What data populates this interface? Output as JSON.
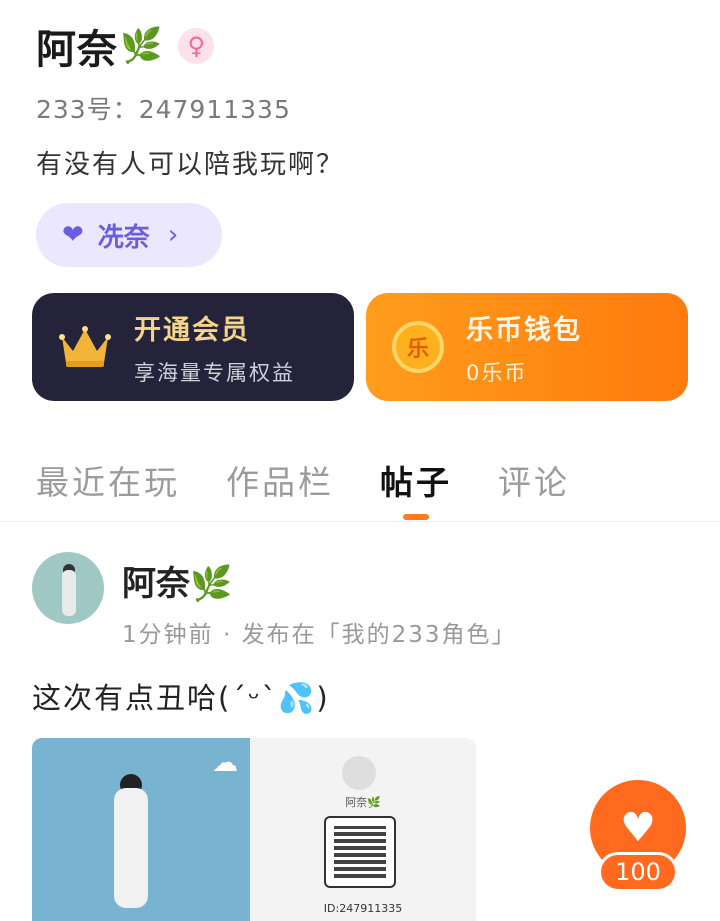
{
  "profile": {
    "name": "阿奈",
    "name_leaf": "🌿",
    "gender_icon": "female-icon",
    "id_label": "233号：",
    "id_value": "247911335",
    "bio": "有没有人可以陪我玩啊？",
    "cp_label": "冼奈",
    "cp_icon": "couple-heart-icon"
  },
  "cards": {
    "vip": {
      "title": "开通会员",
      "subtitle": "享海量专属权益",
      "icon": "crown-icon"
    },
    "wallet": {
      "title": "乐币钱包",
      "subtitle": "0乐币",
      "icon_text": "乐"
    }
  },
  "tabs": [
    {
      "label": "最近在玩",
      "active": false
    },
    {
      "label": "作品栏",
      "active": false
    },
    {
      "label": "帖子",
      "active": true
    },
    {
      "label": "评论",
      "active": false
    }
  ],
  "post": {
    "author": "阿奈",
    "author_leaf": "🌿",
    "time_text": "1分钟前 · 发布在「我的233角色」",
    "content": "这次有点丑哈(´ᵕ`💦)",
    "share_card": {
      "name": "阿奈🌿",
      "id_text": "ID:247911335"
    }
  },
  "like": {
    "count": "100"
  },
  "colors": {
    "accent": "#ff7a1a",
    "vip_bg": "#25233a",
    "cp_pill_bg": "#ebe8fd"
  }
}
